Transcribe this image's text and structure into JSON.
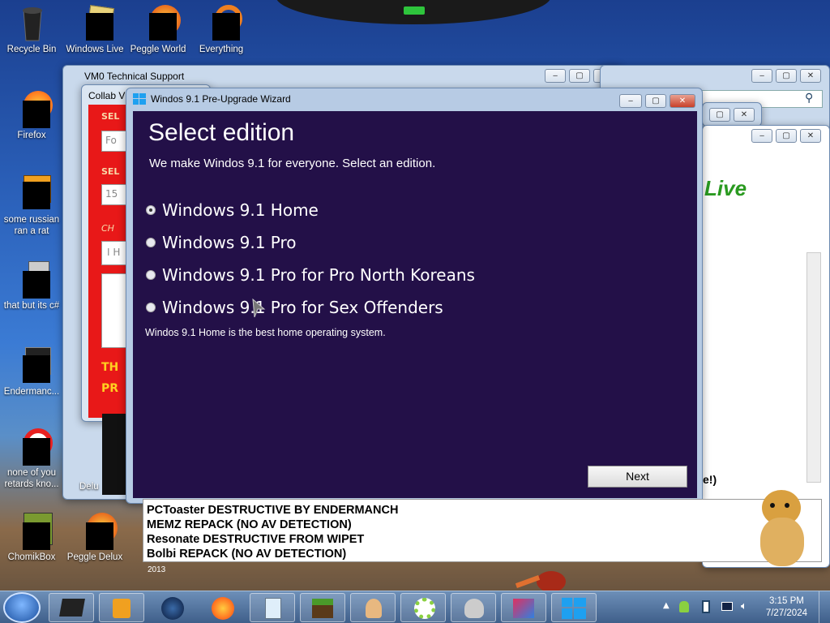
{
  "desktop_icons": [
    {
      "label": "Recycle Bin"
    },
    {
      "label": "Windows Live"
    },
    {
      "label": "Peggle World"
    },
    {
      "label": "Everything"
    },
    {
      "label": "Firefox"
    },
    {
      "label": "some russian ran a rat"
    },
    {
      "label": "that but its c#"
    },
    {
      "label": "Endermanc..."
    },
    {
      "label": "none of you retards kno..."
    },
    {
      "label": "ChomikBox"
    },
    {
      "label": "Peggle Delux"
    }
  ],
  "bg_windows": {
    "support_title": "VM0 Technical Support",
    "collab_title": "Collab VM",
    "red_labels": [
      "SEL",
      "Fo",
      "SEL",
      "15",
      "CH",
      "I H",
      "TH",
      "PR"
    ],
    "side_text": "e!)",
    "year_text": "2013",
    "delu_text": "Delu"
  },
  "wizard": {
    "title": "Windos 9.1 Pre-Upgrade Wizard",
    "heading": "Select edition",
    "subtitle": "We make Windos 9.1 for everyone. Select an edition.",
    "options": [
      {
        "label": "Windows 9.1 Home",
        "selected": true
      },
      {
        "label": "Windows 9.1 Pro",
        "selected": false
      },
      {
        "label": "Windows 9.1 Pro for Pro North Koreans",
        "selected": false
      },
      {
        "label": "Windows 9.1 Pro for Sex Offenders",
        "selected": false
      }
    ],
    "description": "Windos 9.1 Home is the best home operating system.",
    "next_label": "Next"
  },
  "list": [
    "PCToaster DESTRUCTIVE BY ENDERMANCH",
    "MEMZ REPACK (NO AV DETECTION)",
    "Resonate DESTRUCTIVE FROM WIPET",
    "Bolbi REPACK (NO AV DETECTION)"
  ],
  "tray": {
    "time": "3:15 PM",
    "date": "7/27/2024"
  },
  "colors": {
    "wizard_bg": "#231048",
    "collab_red": "#e81818"
  }
}
